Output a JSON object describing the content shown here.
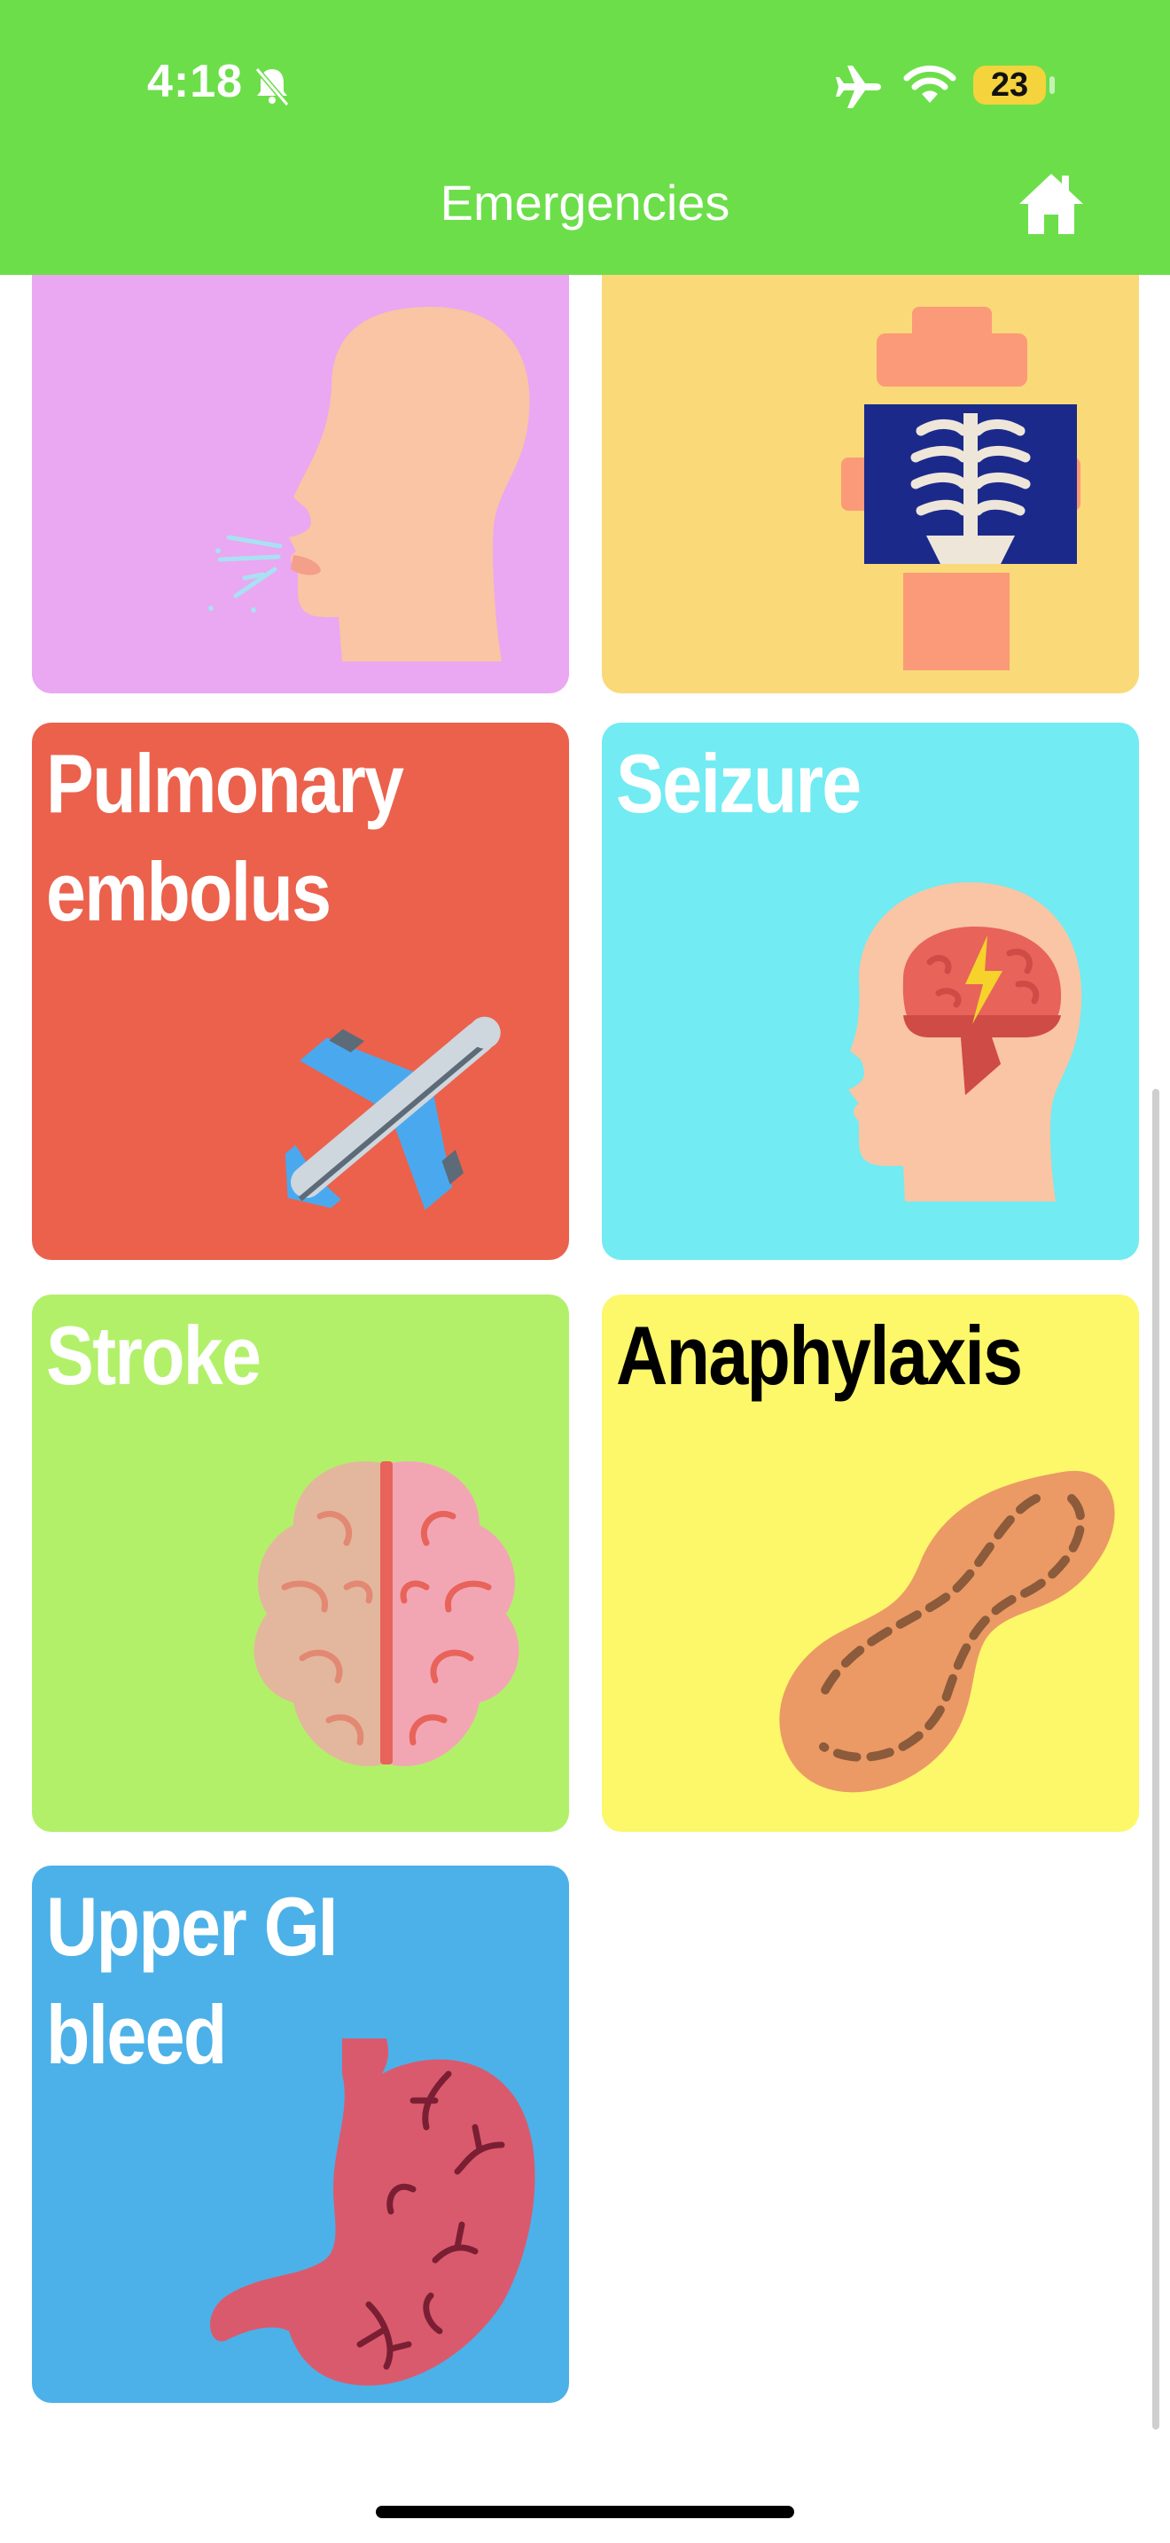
{
  "status_bar": {
    "time": "4:18",
    "battery": "23"
  },
  "header": {
    "title": "Emergencies"
  },
  "tiles": [
    {
      "label": "",
      "color": "#eaa7f2",
      "icon": "breathing-head-icon"
    },
    {
      "label": "",
      "color": "#fad979",
      "icon": "chest-xray-icon"
    },
    {
      "label": "Pulmonary embolus",
      "color": "#eb614c",
      "icon": "airplane-icon"
    },
    {
      "label": "Seizure",
      "color": "#72ebf2",
      "icon": "brain-lightning-head-icon"
    },
    {
      "label": "Stroke",
      "color": "#b2f06a",
      "icon": "brain-icon"
    },
    {
      "label": "Anaphylaxis",
      "color": "#fdf76a",
      "icon": "peanut-icon"
    },
    {
      "label": "Upper GI bleed",
      "color": "#4cb1e8",
      "icon": "stomach-icon"
    }
  ],
  "colors": {
    "header": "#6cde4a",
    "battery": "#f4d33d"
  }
}
